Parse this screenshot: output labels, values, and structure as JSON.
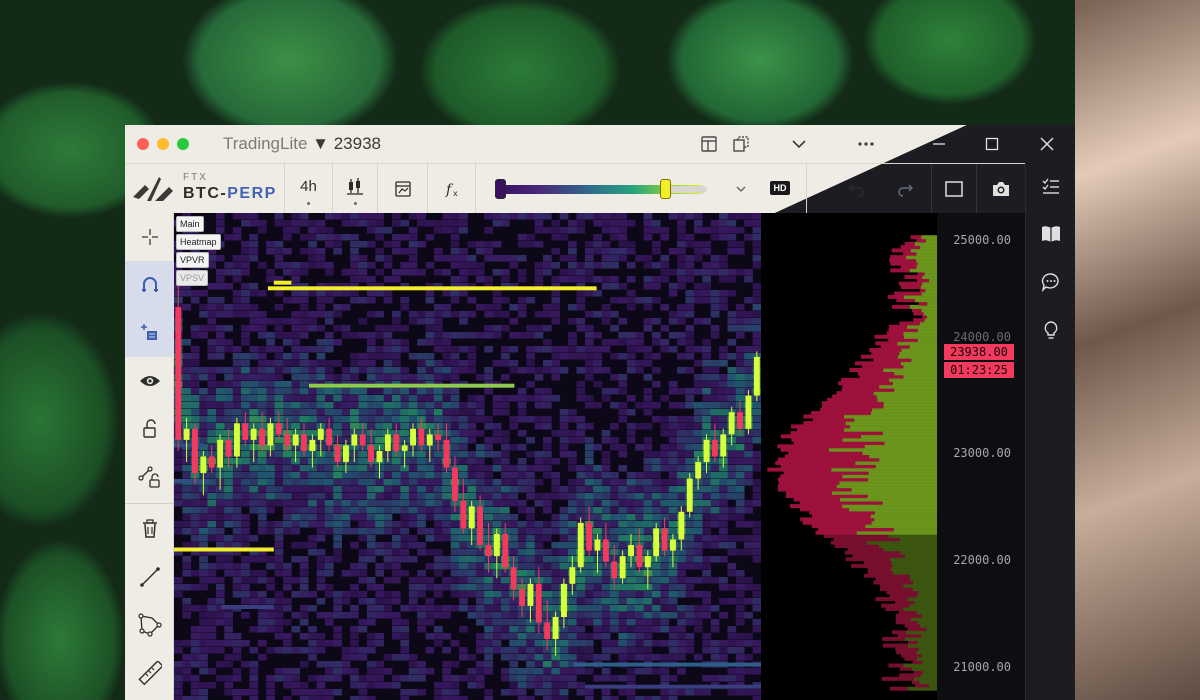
{
  "window": {
    "title": "TradingLite",
    "price": "23938",
    "down_arrow": "▼"
  },
  "brand": {
    "exchange": "FTX",
    "base": "BTC",
    "dash": "-",
    "quote": "PERP"
  },
  "toolbar": {
    "interval": "4h",
    "hd_label": "HD"
  },
  "layers": {
    "main": "Main",
    "heatmap": "Heatmap",
    "vpvr": "VPVR",
    "vpsv": "VPSV"
  },
  "axis": {
    "labels": [
      "25000.00",
      "24000.00",
      "23000.00",
      "22000.00",
      "21000.00"
    ],
    "current_price": "23938.00",
    "countdown": "01:23:25"
  },
  "colors": {
    "accent": "#4164b4",
    "price_tag": "#f23a5e",
    "bull_candle": "#d7ff3a",
    "bear_candle": "#f23a5e",
    "heat_high": "#f3ee2a",
    "heat_low": "#3b1063"
  },
  "icons": {
    "crosshair": "crosshair-icon",
    "magnet": "magnet-icon",
    "add-layer": "add-layer-icon",
    "eye": "eye-icon",
    "lock": "unlock-icon",
    "lock-drawing": "lock-drawing-icon",
    "trash": "trash-icon",
    "line": "trend-line-icon",
    "polygon": "polygon-icon",
    "ruler": "ruler-icon"
  },
  "chart_data": {
    "type": "candlestick",
    "price_range": [
      20800,
      25200
    ],
    "candles": [
      [
        24350,
        24550,
        23050,
        23150
      ],
      [
        23150,
        23350,
        22950,
        23250
      ],
      [
        23250,
        23300,
        22750,
        22850
      ],
      [
        22850,
        23050,
        22650,
        23000
      ],
      [
        23000,
        23100,
        22850,
        22900
      ],
      [
        22900,
        23200,
        22700,
        23150
      ],
      [
        23150,
        23250,
        22900,
        23000
      ],
      [
        23000,
        23350,
        22900,
        23300
      ],
      [
        23300,
        23400,
        23100,
        23150
      ],
      [
        23150,
        23300,
        22950,
        23250
      ],
      [
        23250,
        23400,
        23050,
        23100
      ],
      [
        23100,
        23350,
        23000,
        23300
      ],
      [
        23300,
        23400,
        23150,
        23200
      ],
      [
        23200,
        23350,
        23050,
        23100
      ],
      [
        23100,
        23250,
        22950,
        23200
      ],
      [
        23200,
        23300,
        23000,
        23050
      ],
      [
        23050,
        23200,
        22900,
        23150
      ],
      [
        23150,
        23300,
        23000,
        23250
      ],
      [
        23250,
        23350,
        23050,
        23100
      ],
      [
        23100,
        23200,
        22900,
        22950
      ],
      [
        22950,
        23150,
        22850,
        23100
      ],
      [
        23100,
        23250,
        22950,
        23200
      ],
      [
        23200,
        23300,
        23050,
        23100
      ],
      [
        23100,
        23250,
        22900,
        22950
      ],
      [
        22950,
        23100,
        22800,
        23050
      ],
      [
        23050,
        23250,
        22950,
        23200
      ],
      [
        23200,
        23300,
        23000,
        23050
      ],
      [
        23050,
        23150,
        22900,
        23100
      ],
      [
        23100,
        23300,
        23000,
        23250
      ],
      [
        23250,
        23350,
        23050,
        23100
      ],
      [
        23100,
        23250,
        22950,
        23200
      ],
      [
        23200,
        23300,
        23050,
        23150
      ],
      [
        23150,
        23300,
        22850,
        22900
      ],
      [
        22900,
        23000,
        22500,
        22600
      ],
      [
        22600,
        22800,
        22300,
        22350
      ],
      [
        22350,
        22600,
        22200,
        22550
      ],
      [
        22550,
        22650,
        22150,
        22200
      ],
      [
        22200,
        22400,
        21950,
        22100
      ],
      [
        22100,
        22350,
        21900,
        22300
      ],
      [
        22300,
        22400,
        21950,
        22000
      ],
      [
        22000,
        22100,
        21700,
        21800
      ],
      [
        21800,
        21900,
        21550,
        21650
      ],
      [
        21650,
        21900,
        21500,
        21850
      ],
      [
        21850,
        22000,
        21400,
        21500
      ],
      [
        21500,
        21700,
        21250,
        21350
      ],
      [
        21350,
        21600,
        21200,
        21550
      ],
      [
        21550,
        21900,
        21450,
        21850
      ],
      [
        21850,
        22100,
        21750,
        22000
      ],
      [
        22000,
        22450,
        21950,
        22400
      ],
      [
        22400,
        22550,
        22100,
        22150
      ],
      [
        22150,
        22300,
        21950,
        22250
      ],
      [
        22250,
        22400,
        22000,
        22050
      ],
      [
        22050,
        22200,
        21800,
        21900
      ],
      [
        21900,
        22150,
        21850,
        22100
      ],
      [
        22100,
        22300,
        22000,
        22200
      ],
      [
        22200,
        22350,
        21950,
        22000
      ],
      [
        22000,
        22150,
        21800,
        22100
      ],
      [
        22100,
        22400,
        22050,
        22350
      ],
      [
        22350,
        22450,
        22100,
        22150
      ],
      [
        22150,
        22300,
        22000,
        22250
      ],
      [
        22250,
        22550,
        22150,
        22500
      ],
      [
        22500,
        22850,
        22450,
        22800
      ],
      [
        22800,
        23000,
        22700,
        22950
      ],
      [
        22950,
        23200,
        22850,
        23150
      ],
      [
        23150,
        23300,
        22950,
        23000
      ],
      [
        23000,
        23250,
        22900,
        23200
      ],
      [
        23200,
        23450,
        23100,
        23400
      ],
      [
        23400,
        23500,
        23200,
        23250
      ],
      [
        23250,
        23600,
        23200,
        23550
      ],
      [
        23550,
        23950,
        23500,
        23900
      ]
    ],
    "heat_bands": [
      {
        "price": 24520,
        "x0": 0.16,
        "x1": 0.72,
        "level": 1.0
      },
      {
        "price": 24570,
        "x0": 0.17,
        "x1": 0.2,
        "level": 1.0
      },
      {
        "price": 23640,
        "x0": 0.23,
        "x1": 0.58,
        "level": 0.9
      },
      {
        "price": 22160,
        "x0": 0.0,
        "x1": 0.17,
        "level": 1.0
      },
      {
        "price": 21120,
        "x0": 0.68,
        "x1": 1.0,
        "level": 0.55
      },
      {
        "price": 20920,
        "x0": 0.7,
        "x1": 1.0,
        "level": 0.45
      },
      {
        "price": 21640,
        "x0": 0.08,
        "x1": 0.17,
        "level": 0.45
      },
      {
        "price": 23100,
        "x0": 0.0,
        "x1": 0.05,
        "level": 0.5
      },
      {
        "price": 22780,
        "x0": 0.0,
        "x1": 0.06,
        "level": 0.5
      }
    ],
    "volume_profile_levels": [
      20900,
      25000
    ],
    "current_price": 23938
  }
}
